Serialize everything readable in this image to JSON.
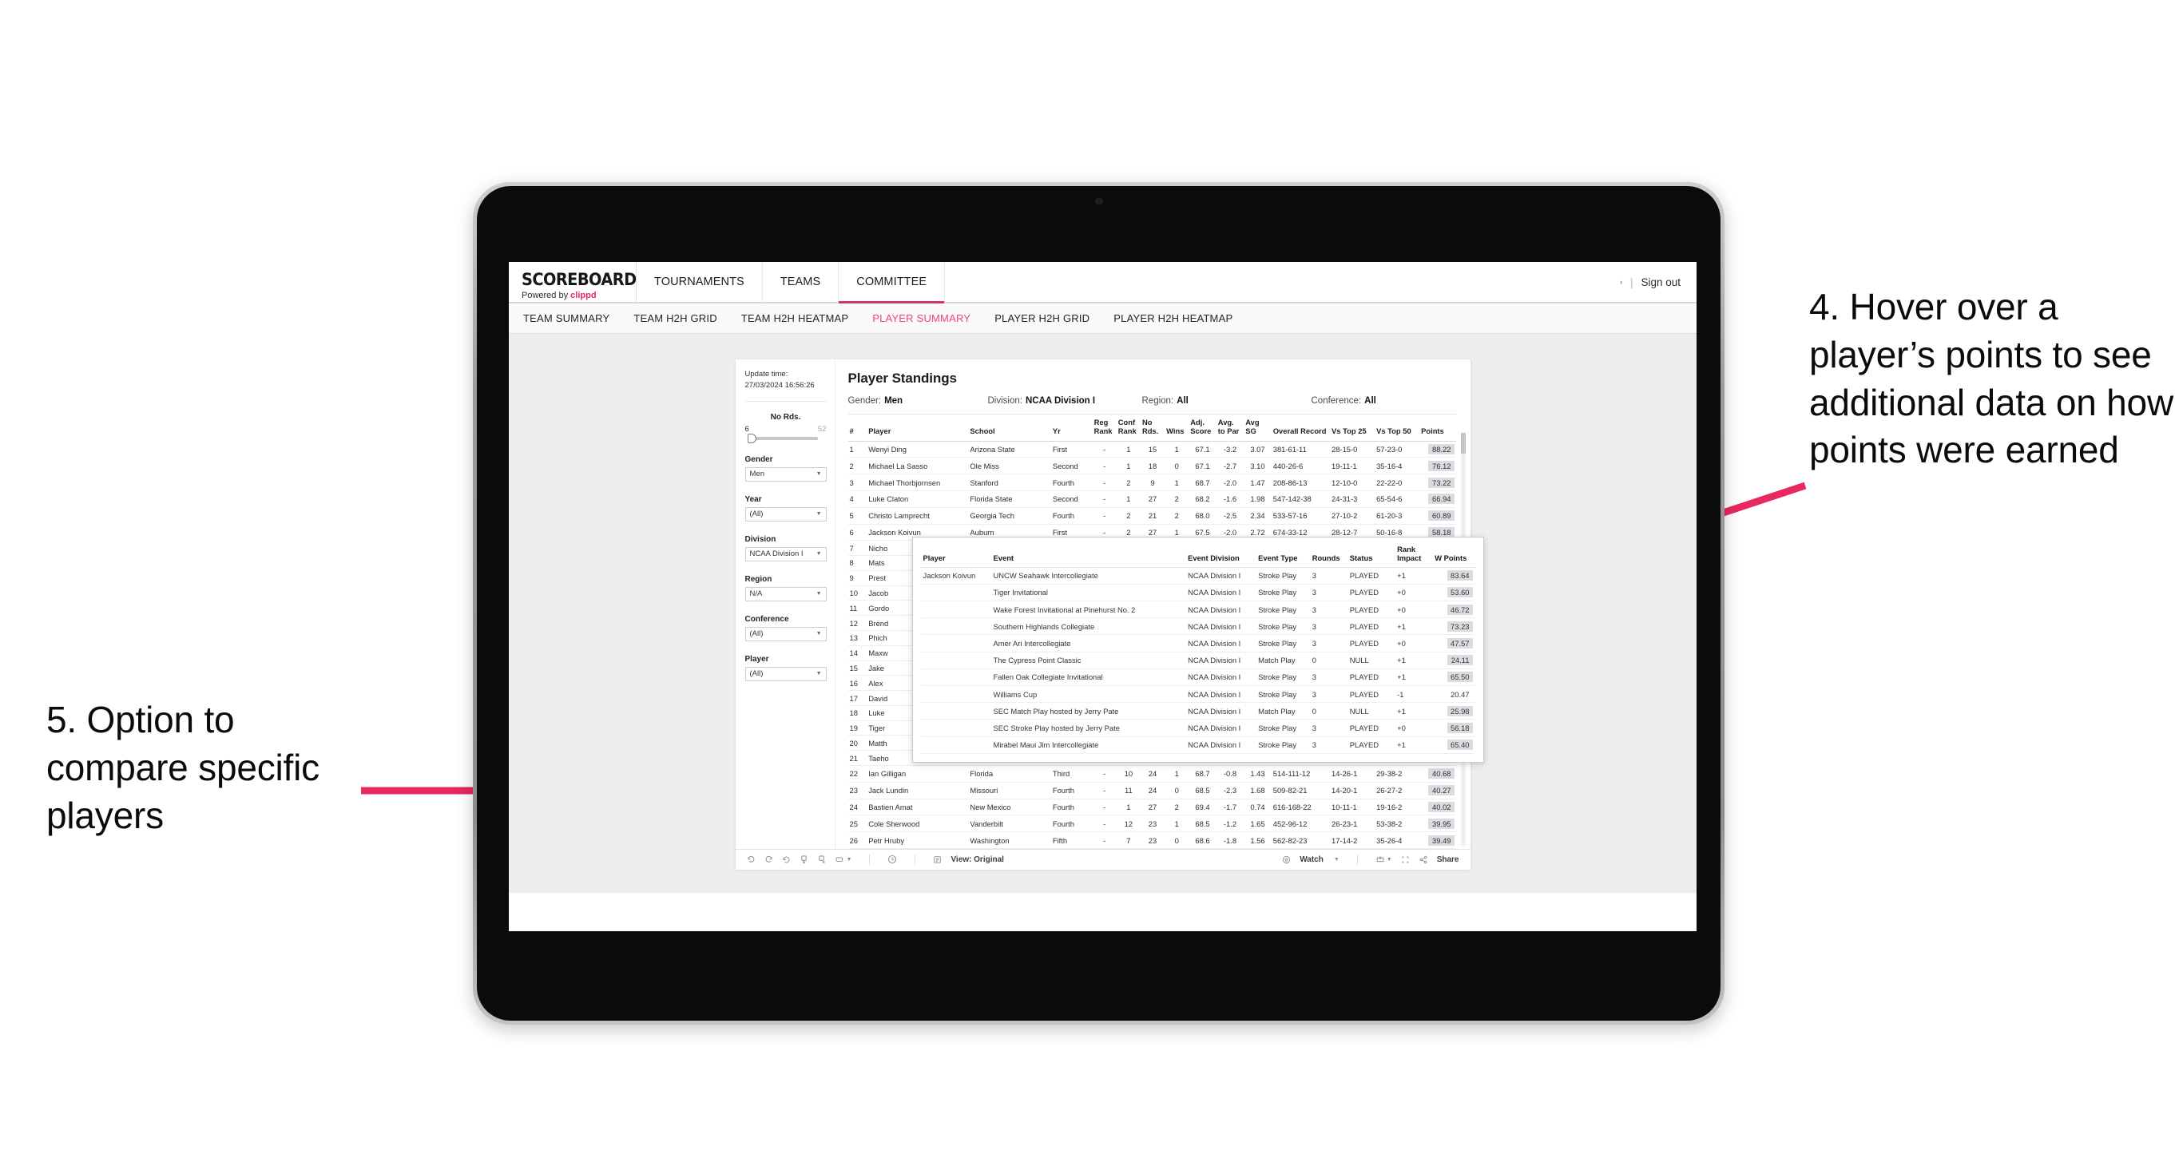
{
  "annotations": {
    "right": "4. Hover over a player’s points to see additional data on how points were earned",
    "left": "5. Option to compare specific players",
    "arrow_color": "#e8285e"
  },
  "app": {
    "brand": {
      "title": "SCOREBOARD",
      "powered_prefix": "Powered by",
      "powered_brand": "clippd"
    },
    "nav": [
      {
        "label": "TOURNAMENTS",
        "active": false
      },
      {
        "label": "TEAMS",
        "active": false
      },
      {
        "label": "COMMITTEE",
        "active": true
      }
    ],
    "nav_right": {
      "caret": "›",
      "separator": "|",
      "sign_out": "Sign out"
    },
    "subnav": [
      {
        "label": "TEAM SUMMARY",
        "active": false
      },
      {
        "label": "TEAM H2H GRID",
        "active": false
      },
      {
        "label": "TEAM H2H HEATMAP",
        "active": false
      },
      {
        "label": "PLAYER SUMMARY",
        "active": true
      },
      {
        "label": "PLAYER H2H GRID",
        "active": false
      },
      {
        "label": "PLAYER H2H HEATMAP",
        "active": false
      }
    ]
  },
  "filters": {
    "update_time_label": "Update time:",
    "update_time_value": "27/03/2024 16:56:26",
    "slider": {
      "label": "No Rds.",
      "min": "6",
      "max": "52"
    },
    "selects": [
      {
        "label": "Gender",
        "value": "Men"
      },
      {
        "label": "Year",
        "value": "(All)"
      },
      {
        "label": "Division",
        "value": "NCAA Division I"
      },
      {
        "label": "Region",
        "value": "N/A"
      },
      {
        "label": "Conference",
        "value": "(All)"
      },
      {
        "label": "Player",
        "value": "(All)"
      }
    ]
  },
  "viz": {
    "title": "Player Standings",
    "summary": [
      {
        "label": "Gender:",
        "value": "Men"
      },
      {
        "label": "Division:",
        "value": "NCAA Division I"
      },
      {
        "label": "Region:",
        "value": "All"
      },
      {
        "label": "Conference:",
        "value": "All"
      }
    ],
    "columns": [
      "#",
      "Player",
      "School",
      "Yr",
      "Reg Rank",
      "Conf Rank",
      "No Rds.",
      "Wins",
      "Adj. Score",
      "Avg. to Par",
      "Avg SG",
      "Overall Record",
      "Vs Top 25",
      "Vs Top 50",
      "Points"
    ],
    "rows": [
      {
        "n": "1",
        "player": "Wenyi Ding",
        "school": "Arizona State",
        "yr": "First",
        "reg": "-",
        "conf": "1",
        "rds": "15",
        "wins": "1",
        "adj": "67.1",
        "par": "-3.2",
        "sg": "3.07",
        "rec": "381-61-11",
        "t25": "28-15-0",
        "t50": "57-23-0",
        "pts": "88.22",
        "highlight": true
      },
      {
        "n": "2",
        "player": "Michael La Sasso",
        "school": "Ole Miss",
        "yr": "Second",
        "reg": "-",
        "conf": "1",
        "rds": "18",
        "wins": "0",
        "adj": "67.1",
        "par": "-2.7",
        "sg": "3.10",
        "rec": "440-26-6",
        "t25": "19-11-1",
        "t50": "35-16-4",
        "pts": "76.12",
        "highlight": true
      },
      {
        "n": "3",
        "player": "Michael Thorbjornsen",
        "school": "Stanford",
        "yr": "Fourth",
        "reg": "-",
        "conf": "2",
        "rds": "9",
        "wins": "1",
        "adj": "68.7",
        "par": "-2.0",
        "sg": "1.47",
        "rec": "208-86-13",
        "t25": "12-10-0",
        "t50": "22-22-0",
        "pts": "73.22",
        "highlight": true
      },
      {
        "n": "4",
        "player": "Luke Claton",
        "school": "Florida State",
        "yr": "Second",
        "reg": "-",
        "conf": "1",
        "rds": "27",
        "wins": "2",
        "adj": "68.2",
        "par": "-1.6",
        "sg": "1.98",
        "rec": "547-142-38",
        "t25": "24-31-3",
        "t50": "65-54-6",
        "pts": "66.94",
        "highlight": true
      },
      {
        "n": "5",
        "player": "Christo Lamprecht",
        "school": "Georgia Tech",
        "yr": "Fourth",
        "reg": "-",
        "conf": "2",
        "rds": "21",
        "wins": "2",
        "adj": "68.0",
        "par": "-2.5",
        "sg": "2.34",
        "rec": "533-57-16",
        "t25": "27-10-2",
        "t50": "61-20-3",
        "pts": "60.89",
        "highlight": true
      },
      {
        "n": "6",
        "player": "Jackson Koivun",
        "school": "Auburn",
        "yr": "First",
        "reg": "-",
        "conf": "2",
        "rds": "27",
        "wins": "1",
        "adj": "67.5",
        "par": "-2.0",
        "sg": "2.72",
        "rec": "674-33-12",
        "t25": "28-12-7",
        "t50": "50-16-8",
        "pts": "58.18",
        "highlight": true
      },
      {
        "n": "7",
        "player": "Nicho",
        "school": "",
        "yr": "",
        "reg": "",
        "conf": "",
        "rds": "",
        "wins": "",
        "adj": "",
        "par": "",
        "sg": "",
        "rec": "",
        "t25": "",
        "t50": "",
        "pts": "",
        "highlight": false
      },
      {
        "n": "8",
        "player": "Mats",
        "school": "",
        "yr": "",
        "reg": "",
        "conf": "",
        "rds": "",
        "wins": "",
        "adj": "",
        "par": "",
        "sg": "",
        "rec": "",
        "t25": "",
        "t50": "",
        "pts": "",
        "highlight": false
      },
      {
        "n": "9",
        "player": "Prest",
        "school": "",
        "yr": "",
        "reg": "",
        "conf": "",
        "rds": "",
        "wins": "",
        "adj": "",
        "par": "",
        "sg": "",
        "rec": "",
        "t25": "",
        "t50": "",
        "pts": "",
        "highlight": false
      },
      {
        "n": "10",
        "player": "Jacob",
        "school": "",
        "yr": "",
        "reg": "",
        "conf": "",
        "rds": "",
        "wins": "",
        "adj": "",
        "par": "",
        "sg": "",
        "rec": "",
        "t25": "",
        "t50": "",
        "pts": "",
        "highlight": false
      },
      {
        "n": "11",
        "player": "Gordo",
        "school": "",
        "yr": "",
        "reg": "",
        "conf": "",
        "rds": "",
        "wins": "",
        "adj": "",
        "par": "",
        "sg": "",
        "rec": "",
        "t25": "",
        "t50": "",
        "pts": "",
        "highlight": false
      },
      {
        "n": "12",
        "player": "Brend",
        "school": "",
        "yr": "",
        "reg": "",
        "conf": "",
        "rds": "",
        "wins": "",
        "adj": "",
        "par": "",
        "sg": "",
        "rec": "",
        "t25": "",
        "t50": "",
        "pts": "",
        "highlight": false
      },
      {
        "n": "13",
        "player": "Phich",
        "school": "",
        "yr": "",
        "reg": "",
        "conf": "",
        "rds": "",
        "wins": "",
        "adj": "",
        "par": "",
        "sg": "",
        "rec": "",
        "t25": "",
        "t50": "",
        "pts": "",
        "highlight": false
      },
      {
        "n": "14",
        "player": "Maxw",
        "school": "",
        "yr": "",
        "reg": "",
        "conf": "",
        "rds": "",
        "wins": "",
        "adj": "",
        "par": "",
        "sg": "",
        "rec": "",
        "t25": "",
        "t50": "",
        "pts": "",
        "highlight": false
      },
      {
        "n": "15",
        "player": "Jake",
        "school": "",
        "yr": "",
        "reg": "",
        "conf": "",
        "rds": "",
        "wins": "",
        "adj": "",
        "par": "",
        "sg": "",
        "rec": "",
        "t25": "",
        "t50": "",
        "pts": "",
        "highlight": false
      },
      {
        "n": "16",
        "player": "Alex",
        "school": "",
        "yr": "",
        "reg": "",
        "conf": "",
        "rds": "",
        "wins": "",
        "adj": "",
        "par": "",
        "sg": "",
        "rec": "",
        "t25": "",
        "t50": "",
        "pts": "",
        "highlight": false
      },
      {
        "n": "17",
        "player": "David",
        "school": "",
        "yr": "",
        "reg": "",
        "conf": "",
        "rds": "",
        "wins": "",
        "adj": "",
        "par": "",
        "sg": "",
        "rec": "",
        "t25": "",
        "t50": "",
        "pts": "",
        "highlight": false
      },
      {
        "n": "18",
        "player": "Luke",
        "school": "",
        "yr": "",
        "reg": "",
        "conf": "",
        "rds": "",
        "wins": "",
        "adj": "",
        "par": "",
        "sg": "",
        "rec": "",
        "t25": "",
        "t50": "",
        "pts": "",
        "highlight": false
      },
      {
        "n": "19",
        "player": "Tiger",
        "school": "",
        "yr": "",
        "reg": "",
        "conf": "",
        "rds": "",
        "wins": "",
        "adj": "",
        "par": "",
        "sg": "",
        "rec": "",
        "t25": "",
        "t50": "",
        "pts": "",
        "highlight": false
      },
      {
        "n": "20",
        "player": "Matth",
        "school": "",
        "yr": "",
        "reg": "",
        "conf": "",
        "rds": "",
        "wins": "",
        "adj": "",
        "par": "",
        "sg": "",
        "rec": "",
        "t25": "",
        "t50": "",
        "pts": "",
        "highlight": false
      },
      {
        "n": "21",
        "player": "Taeho",
        "school": "",
        "yr": "",
        "reg": "",
        "conf": "",
        "rds": "",
        "wins": "",
        "adj": "",
        "par": "",
        "sg": "",
        "rec": "",
        "t25": "",
        "t50": "",
        "pts": "",
        "highlight": false
      },
      {
        "n": "22",
        "player": "Ian Gilligan",
        "school": "Florida",
        "yr": "Third",
        "reg": "-",
        "conf": "10",
        "rds": "24",
        "wins": "1",
        "adj": "68.7",
        "par": "-0.8",
        "sg": "1.43",
        "rec": "514-111-12",
        "t25": "14-26-1",
        "t50": "29-38-2",
        "pts": "40.68",
        "highlight": true
      },
      {
        "n": "23",
        "player": "Jack Lundin",
        "school": "Missouri",
        "yr": "Fourth",
        "reg": "-",
        "conf": "11",
        "rds": "24",
        "wins": "0",
        "adj": "68.5",
        "par": "-2.3",
        "sg": "1.68",
        "rec": "509-82-21",
        "t25": "14-20-1",
        "t50": "26-27-2",
        "pts": "40.27",
        "highlight": true
      },
      {
        "n": "24",
        "player": "Bastien Amat",
        "school": "New Mexico",
        "yr": "Fourth",
        "reg": "-",
        "conf": "1",
        "rds": "27",
        "wins": "2",
        "adj": "69.4",
        "par": "-1.7",
        "sg": "0.74",
        "rec": "616-168-22",
        "t25": "10-11-1",
        "t50": "19-16-2",
        "pts": "40.02",
        "highlight": true
      },
      {
        "n": "25",
        "player": "Cole Sherwood",
        "school": "Vanderbilt",
        "yr": "Fourth",
        "reg": "-",
        "conf": "12",
        "rds": "23",
        "wins": "1",
        "adj": "68.5",
        "par": "-1.2",
        "sg": "1.65",
        "rec": "452-96-12",
        "t25": "26-23-1",
        "t50": "53-38-2",
        "pts": "39.95",
        "highlight": true
      },
      {
        "n": "26",
        "player": "Petr Hruby",
        "school": "Washington",
        "yr": "Fifth",
        "reg": "-",
        "conf": "7",
        "rds": "23",
        "wins": "0",
        "adj": "68.6",
        "par": "-1.8",
        "sg": "1.56",
        "rec": "562-82-23",
        "t25": "17-14-2",
        "t50": "35-26-4",
        "pts": "39.49",
        "highlight": true
      }
    ]
  },
  "tooltip": {
    "columns": [
      "Player",
      "Event",
      "Event Division",
      "Event Type",
      "Rounds",
      "Status",
      "Rank Impact",
      "W Points"
    ],
    "player": "Jackson Koivun",
    "rows": [
      {
        "event": "UNCW Seahawk Intercollegiate",
        "division": "NCAA Division I",
        "type": "Stroke Play",
        "rounds": "3",
        "status": "PLAYED",
        "rank": "+1",
        "points": "83.64",
        "highlight": true
      },
      {
        "event": "Tiger Invitational",
        "division": "NCAA Division I",
        "type": "Stroke Play",
        "rounds": "3",
        "status": "PLAYED",
        "rank": "+0",
        "points": "53.60",
        "highlight": true
      },
      {
        "event": "Wake Forest Invitational at Pinehurst No. 2",
        "division": "NCAA Division I",
        "type": "Stroke Play",
        "rounds": "3",
        "status": "PLAYED",
        "rank": "+0",
        "points": "46.72",
        "highlight": true
      },
      {
        "event": "Southern Highlands Collegiate",
        "division": "NCAA Division I",
        "type": "Stroke Play",
        "rounds": "3",
        "status": "PLAYED",
        "rank": "+1",
        "points": "73.23",
        "highlight": true
      },
      {
        "event": "Amer Ari Intercollegiate",
        "division": "NCAA Division I",
        "type": "Stroke Play",
        "rounds": "3",
        "status": "PLAYED",
        "rank": "+0",
        "points": "47.57",
        "highlight": true
      },
      {
        "event": "The Cypress Point Classic",
        "division": "NCAA Division I",
        "type": "Match Play",
        "rounds": "0",
        "status": "NULL",
        "rank": "+1",
        "points": "24.11",
        "highlight": true
      },
      {
        "event": "Fallen Oak Collegiate Invitational",
        "division": "NCAA Division I",
        "type": "Stroke Play",
        "rounds": "3",
        "status": "PLAYED",
        "rank": "+1",
        "points": "65.50",
        "highlight": true
      },
      {
        "event": "Williams Cup",
        "division": "NCAA Division I",
        "type": "Stroke Play",
        "rounds": "3",
        "status": "PLAYED",
        "rank": "-1",
        "points": "20.47",
        "highlight": false
      },
      {
        "event": "SEC Match Play hosted by Jerry Pate",
        "division": "NCAA Division I",
        "type": "Match Play",
        "rounds": "0",
        "status": "NULL",
        "rank": "+1",
        "points": "25.98",
        "highlight": true
      },
      {
        "event": "SEC Stroke Play hosted by Jerry Pate",
        "division": "NCAA Division I",
        "type": "Stroke Play",
        "rounds": "3",
        "status": "PLAYED",
        "rank": "+0",
        "points": "56.18",
        "highlight": true
      },
      {
        "event": "Mirabel Maui Jim Intercollegiate",
        "division": "NCAA Division I",
        "type": "Stroke Play",
        "rounds": "3",
        "status": "PLAYED",
        "rank": "+1",
        "points": "65.40",
        "highlight": true
      }
    ]
  },
  "vizbar": {
    "view_label": "View: Original",
    "watch_label": "Watch",
    "share_label": "Share"
  }
}
